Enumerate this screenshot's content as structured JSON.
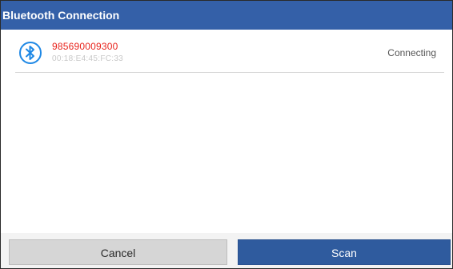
{
  "dialog": {
    "title": "Bluetooth Connection"
  },
  "devices": [
    {
      "name": "985690009300",
      "mac": "00:18:E4:45:FC:33",
      "status": "Connecting",
      "icon": "bluetooth-icon"
    }
  ],
  "buttons": {
    "cancel_label": "Cancel",
    "scan_label": "Scan"
  },
  "colors": {
    "title_bar": "#3460a8",
    "accent": "#1e88e5",
    "device_name": "#e8231c",
    "scan_button": "#2f5b9e",
    "cancel_button": "#d6d6d6"
  }
}
